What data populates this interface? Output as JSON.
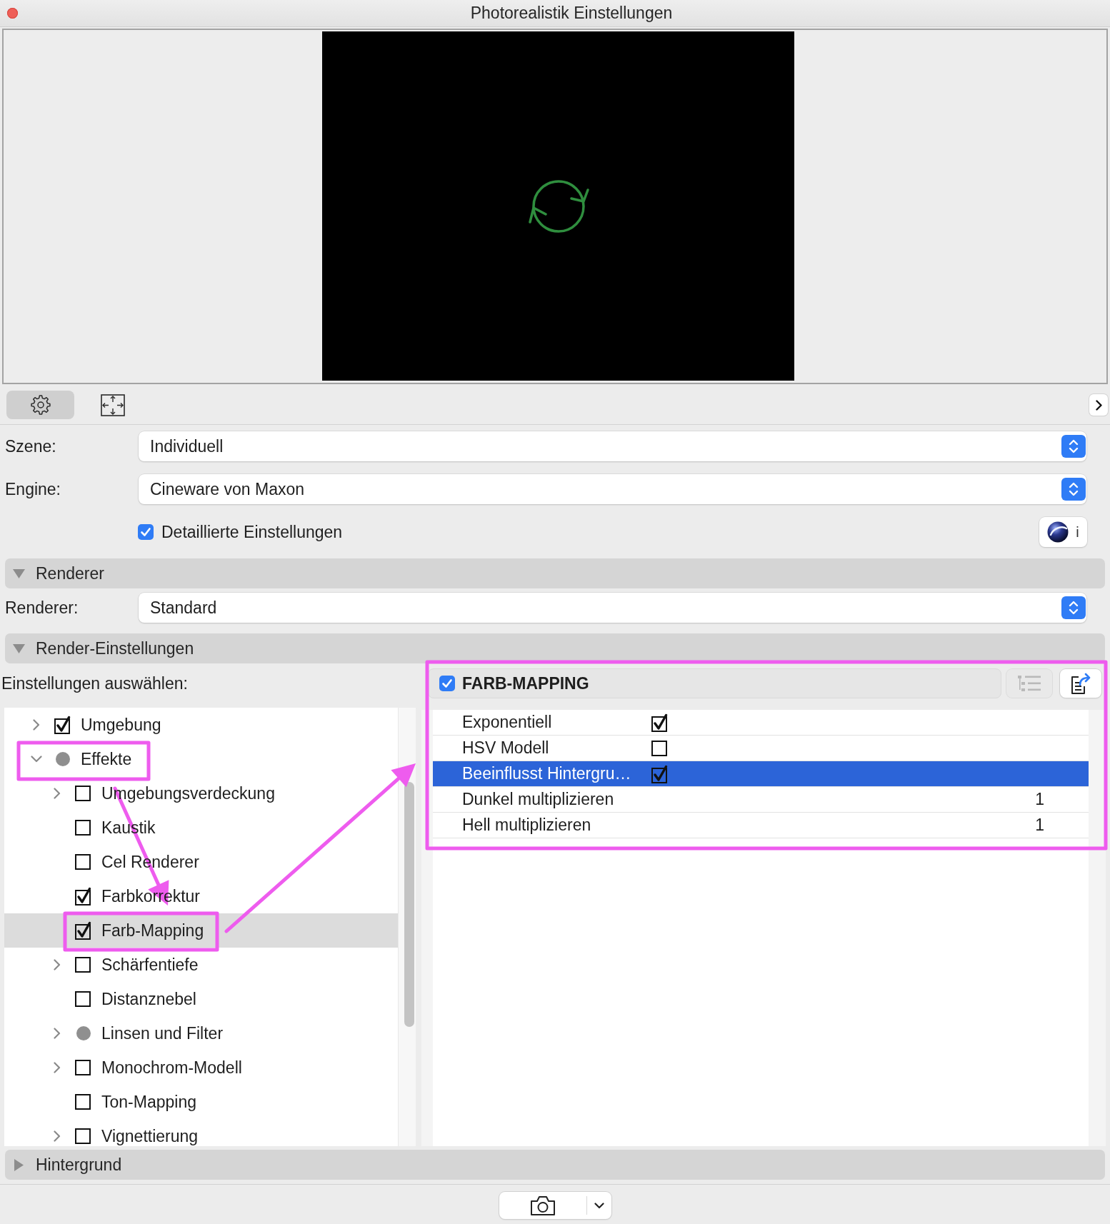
{
  "window": {
    "title": "Photorealistik Einstellungen"
  },
  "toolbar": {
    "tabs": [
      {
        "selected": true
      },
      {
        "selected": false
      }
    ]
  },
  "scene": {
    "label": "Szene:",
    "value": "Individuell"
  },
  "engine": {
    "label": "Engine:",
    "value": "Cineware von Maxon"
  },
  "detailed_settings": {
    "label": "Detaillierte Einstellungen",
    "checked": true
  },
  "info_button": {
    "label": "i"
  },
  "renderer_section": {
    "title": "Renderer",
    "expanded": true,
    "renderer": {
      "label": "Renderer:",
      "value": "Standard"
    }
  },
  "render_settings_section": {
    "title": "Render-Einstellungen",
    "expanded": true,
    "prompt": "Einstellungen auswählen:",
    "tree": [
      {
        "label": "Umgebung",
        "kind": "option",
        "checked": true,
        "expanded": false,
        "selected": false
      },
      {
        "label": "Effekte",
        "kind": "category",
        "expanded": true,
        "selected": false,
        "children": [
          {
            "label": "Umgebungsverdeckung",
            "kind": "option",
            "checked": false,
            "expanded": false,
            "selected": false
          },
          {
            "label": "Kaustik",
            "kind": "option",
            "checked": false,
            "selected": false
          },
          {
            "label": "Cel Renderer",
            "kind": "option",
            "checked": false,
            "selected": false
          },
          {
            "label": "Farbkorrektur",
            "kind": "option",
            "checked": true,
            "selected": false
          },
          {
            "label": "Farb-Mapping",
            "kind": "option",
            "checked": true,
            "selected": true
          },
          {
            "label": "Schärfentiefe",
            "kind": "option",
            "checked": false,
            "expanded": false,
            "selected": false
          },
          {
            "label": "Distanznebel",
            "kind": "option",
            "checked": false,
            "selected": false
          },
          {
            "label": "Linsen und Filter",
            "kind": "category",
            "expanded": false,
            "selected": false
          },
          {
            "label": "Monochrom-Modell",
            "kind": "option",
            "checked": false,
            "expanded": false,
            "selected": false
          },
          {
            "label": "Ton-Mapping",
            "kind": "option",
            "checked": false,
            "selected": false
          },
          {
            "label": "Vignettierung",
            "kind": "option",
            "checked": false,
            "expanded": false,
            "selected": false
          }
        ]
      }
    ],
    "panel": {
      "enabled": true,
      "title": "FARB-MAPPING",
      "rows": [
        {
          "kind": "checkbox",
          "label": "Exponentiell",
          "checked": true,
          "selected": false
        },
        {
          "kind": "checkbox",
          "label": "HSV Modell",
          "checked": false,
          "selected": false
        },
        {
          "kind": "checkbox",
          "label": "Beeinflusst Hintergru…",
          "checked": true,
          "selected": true
        },
        {
          "kind": "number",
          "label": "Dunkel multiplizieren",
          "value": "1",
          "selected": false
        },
        {
          "kind": "number",
          "label": "Hell multiplizieren",
          "value": "1",
          "selected": false
        }
      ]
    }
  },
  "background_section": {
    "title": "Hintergrund",
    "expanded": false
  },
  "annotations": [
    {
      "kind": "frame"
    },
    {
      "kind": "arrow"
    },
    {
      "kind": "frame"
    },
    {
      "kind": "arrow"
    },
    {
      "kind": "frame"
    }
  ]
}
